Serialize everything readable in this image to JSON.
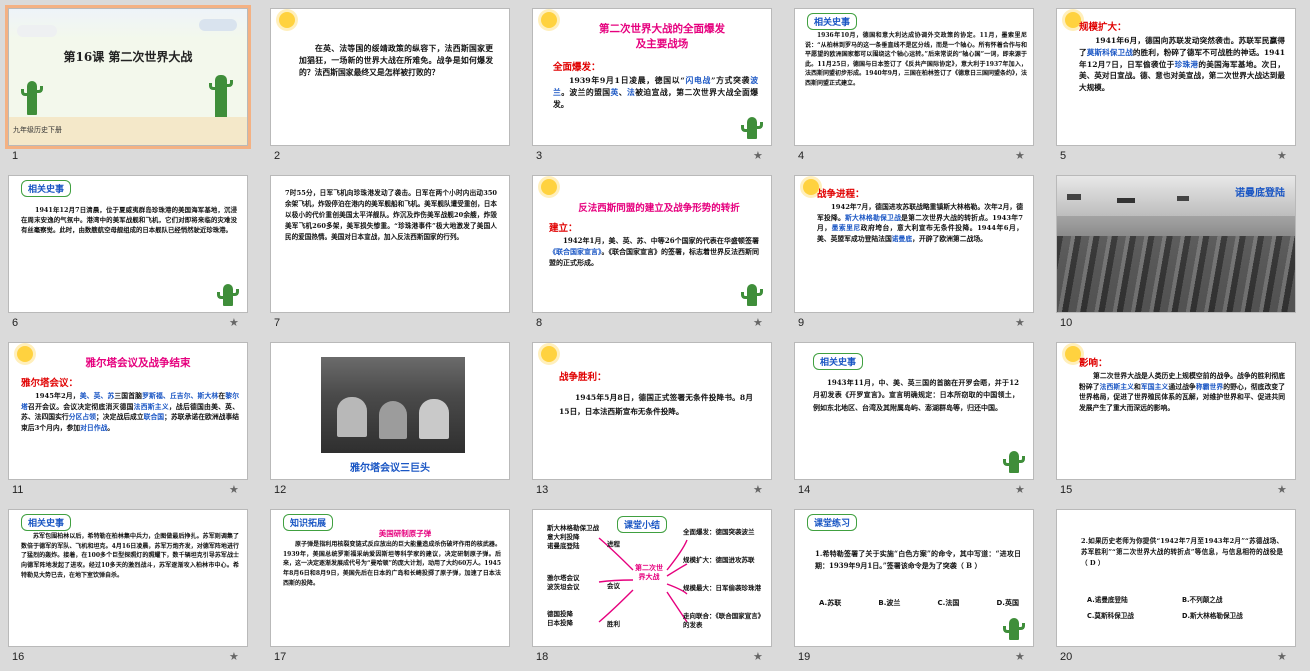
{
  "slides": [
    {
      "n": "1",
      "title": "第16课  第二次世界大战",
      "footer": "九年级历史下册"
    },
    {
      "n": "2",
      "body": "在英、法等国的绥靖政策的纵容下，法西斯国家更加猖狂，一场新的世界大战在所难免。战争是如何爆发的？法西斯国家最终又是怎样被打败的？"
    },
    {
      "n": "3",
      "title1": "第二次世界大战的全面爆发",
      "title2": "及主要战场",
      "sub": "全面爆发：",
      "body_a": "1939年9月1日凌晨，德国以“",
      "hl1": "闪电战",
      "body_b": "”方式突袭",
      "hl2": "波兰",
      "body_c": "。波兰的盟国",
      "hl3": "英",
      "body_d": "、",
      "hl4": "法",
      "body_e": "被迫宣战，第二次世界大战全面爆发。"
    },
    {
      "n": "4",
      "tag": "相关史事",
      "body": "1936年10月，德国和意大利达成协调外交政策的协定。11月，墨索里尼说：“从柏林到罗马的这一条垂直线不是区分线，而是一个轴心。所有怀着合作与和平愿望的欧洲国家都可以围绕这个轴心运转。”后来常说的“轴心国”一词，即来源于此。11月25日，德国与日本签订了《反共产国际协定》，意大利于1937年加入，法西斯同盟初步形成。1940年9月，三国在柏林签订了《德意日三国同盟条约》，法西斯同盟正式建立。"
    },
    {
      "n": "5",
      "sub": "规模扩大：",
      "body_a": "1941年6月，德国向苏联发动突然袭击。苏联军民赢得了",
      "hl1": "莫斯科保卫战",
      "body_b": "的胜利，粉碎了德军不可战胜的神话。1941年12月7日，日军偷袭位于",
      "hl2": "珍珠港",
      "body_c": "的美国海军基地。次日，美、英对日宣战。德、意也对美宣战，第二次世界大战达到最大规模。"
    },
    {
      "n": "6",
      "tag": "相关史事",
      "body": "1941年12月7日清晨，位于夏威夷群岛珍珠港的美国海军基地，沉浸在周末安逸的气氛中。港湾中的美军战舰和飞机，它们对即将来临的灾难没有丝毫察觉。此时，由数艘航空母舰组成的日本舰队已经悄然驶近珍珠港。"
    },
    {
      "n": "7",
      "body": "7时55分，日军飞机向珍珠港发动了袭击。日军在两个小时内出动350余架飞机，炸毁停泊在港内的美军舰船和飞机。美军舰队遭受重创，日本以极小的代价重创美国太平洋舰队。炸沉及炸伤美军战舰20余艘，炸毁美军飞机260多架，美军损失惨重。“珍珠港事件”极大地激发了美国人民的爱国热情。美国对日本宣战，加入反法西斯国家的行列。"
    },
    {
      "n": "8",
      "title": "反法西斯同盟的建立及战争形势的转折",
      "sub": "建立：",
      "body_a": "1942年1月，美、英、苏、中等26个国家的代表在华盛顿签署",
      "hl1": "《联合国家宣言》",
      "body_b": "。《联合国家宣言》的签署，标志着世界反法西斯同盟的正式形成。"
    },
    {
      "n": "9",
      "sub": "战争进程：",
      "body_a": "1942年7月，德国进攻苏联战略重镇斯大林格勒。次年2月，德军投降。",
      "hl1": "斯大林格勒保卫战",
      "body_b": "是第二次世界大战的转折点。1943年7月，",
      "hl2": "墨索里尼",
      "body_c": "政府垮台，意大利宣布无条件投降。1944年6月，美、英盟军成功登陆法国",
      "hl3": "诺曼底",
      "body_d": "，开辟了欧洲第二战场。"
    },
    {
      "n": "10",
      "caption": "诺曼底登陆"
    },
    {
      "n": "11",
      "title": "雅尔塔会议及战争结束",
      "sub": "雅尔塔会议：",
      "body_a": "1945年2月，",
      "hl1": "美、英、苏",
      "body_b": "三国首脑",
      "hl2": "罗斯福、丘吉尔、斯大林",
      "body_c": "在",
      "hl3": "黎尔塔",
      "body_d": "召开会议。会议决定彻底消灭德国",
      "hl4": "法西斯主义",
      "body_e": "，战后德国由美、英、苏、法四国实行",
      "hl5": "分区占领",
      "body_f": "；决定战后成立",
      "hl6": "联合国",
      "body_g": "；苏联承诺在欧洲战事结束后3个月内，参加",
      "hl7": "对日作战",
      "body_h": "。"
    },
    {
      "n": "12",
      "caption": "雅尔塔会议三巨头"
    },
    {
      "n": "13",
      "sub": "战争胜利：",
      "body": "1945年5月8日，德国正式签署无条件投降书。8月15日，日本法西斯宣布无条件投降。"
    },
    {
      "n": "14",
      "tag": "相关史事",
      "body": "1943年11月，中、美、英三国的首脑在开罗会晤，并于12月初发表《开罗宣言》。宣言明确规定：日本所窃取的中国领土，例如东北地区、台湾及其附属岛屿、澎湖群岛等，归还中国。"
    },
    {
      "n": "15",
      "sub": "影响：",
      "body_a": "第二次世界大战是人类历史上规模空前的战争。战争的胜利彻底粉碎了",
      "hl1": "法西斯主义",
      "body_b": "和",
      "hl2": "军国主义",
      "body_c": "通过战争",
      "hl3": "称霸世界",
      "body_d": "的野心，彻底改变了世界格局，促进了世界殖民体系的瓦解，对维护世界和平、促进共同发展产生了重大而深远的影响。"
    },
    {
      "n": "16",
      "tag": "相关史事",
      "body": "苏军包围柏林以后，希特勒在柏林集中兵力，企图做最后挣扎。苏军则调集了数倍于德军的军队、飞机和坦克。4月16日凌晨，苏军万炮齐发，对德军阵地进行了猛烈的轰炸。接着，在100多个巨型探照灯的照耀下，数千辆坦克引导苏军战士向德军阵地发起了进攻。经过10多天的激烈战斗，苏军逐渐攻入柏林市中心。希特勒见大势已去，在地下室饮弹自杀。"
    },
    {
      "n": "17",
      "tag": "知识拓展",
      "title": "美国研制原子弹",
      "body": "原子弹是指利用核裂变链式反应放出的巨大能量造成杀伤破坏作用的核武器。1939年，美国总统罗斯福采纳爱因斯坦等科学家的建议，决定研制原子弹。后来，这一决定逐渐发展成代号为“曼哈顿”的庞大计划，动用了大约60万人。1945年8月6日和8月9日，美国先后在日本的广岛和长崎投掷了原子弹，加速了日本法西斯的投降。"
    },
    {
      "n": "18",
      "tag": "课堂小结",
      "center": "第二次世界大战",
      "left_top": "斯大林格勒保卫战",
      "left_mid1": "意大利投降",
      "left_mid2": "诺曼底登陆",
      "left_label1": "进程",
      "left_conf": "雅尔塔会议",
      "left_conf2": "波茨坦会议",
      "left_label2": "会议",
      "left_end1": "德国投降",
      "left_end2": "日本投降",
      "left_label3": "胜利",
      "r1": "全面爆发：德国突袭波兰",
      "r2": "规模扩大：德国进攻苏联",
      "r3": "规模最大：日军偷袭珍珠港",
      "r4": "走向联合：《联合国家宣言》的发表"
    },
    {
      "n": "19",
      "tag": "课堂练习",
      "q": "1.希特勒签署了关于实施“白色方案”的命令，其中写道：“进攻日期：1939年9月1日。”签署该命令是为了突袭（  B  ）",
      "ans": "B",
      "opts": [
        "A.苏联",
        "B.波兰",
        "C.法国",
        "D.英国"
      ]
    },
    {
      "n": "20",
      "q": "2.如果历史老师为你提供“1942年7月至1943年2月”“苏德战场、苏军胜利”“第二次世界大战的转折点”等信息，与信息相符的战役是（  D  ）",
      "ans": "D",
      "opts": [
        "A.诺曼底登陆",
        "B.不列颠之战",
        "C.莫斯科保卫战",
        "D.斯大林格勒保卫战"
      ]
    }
  ]
}
